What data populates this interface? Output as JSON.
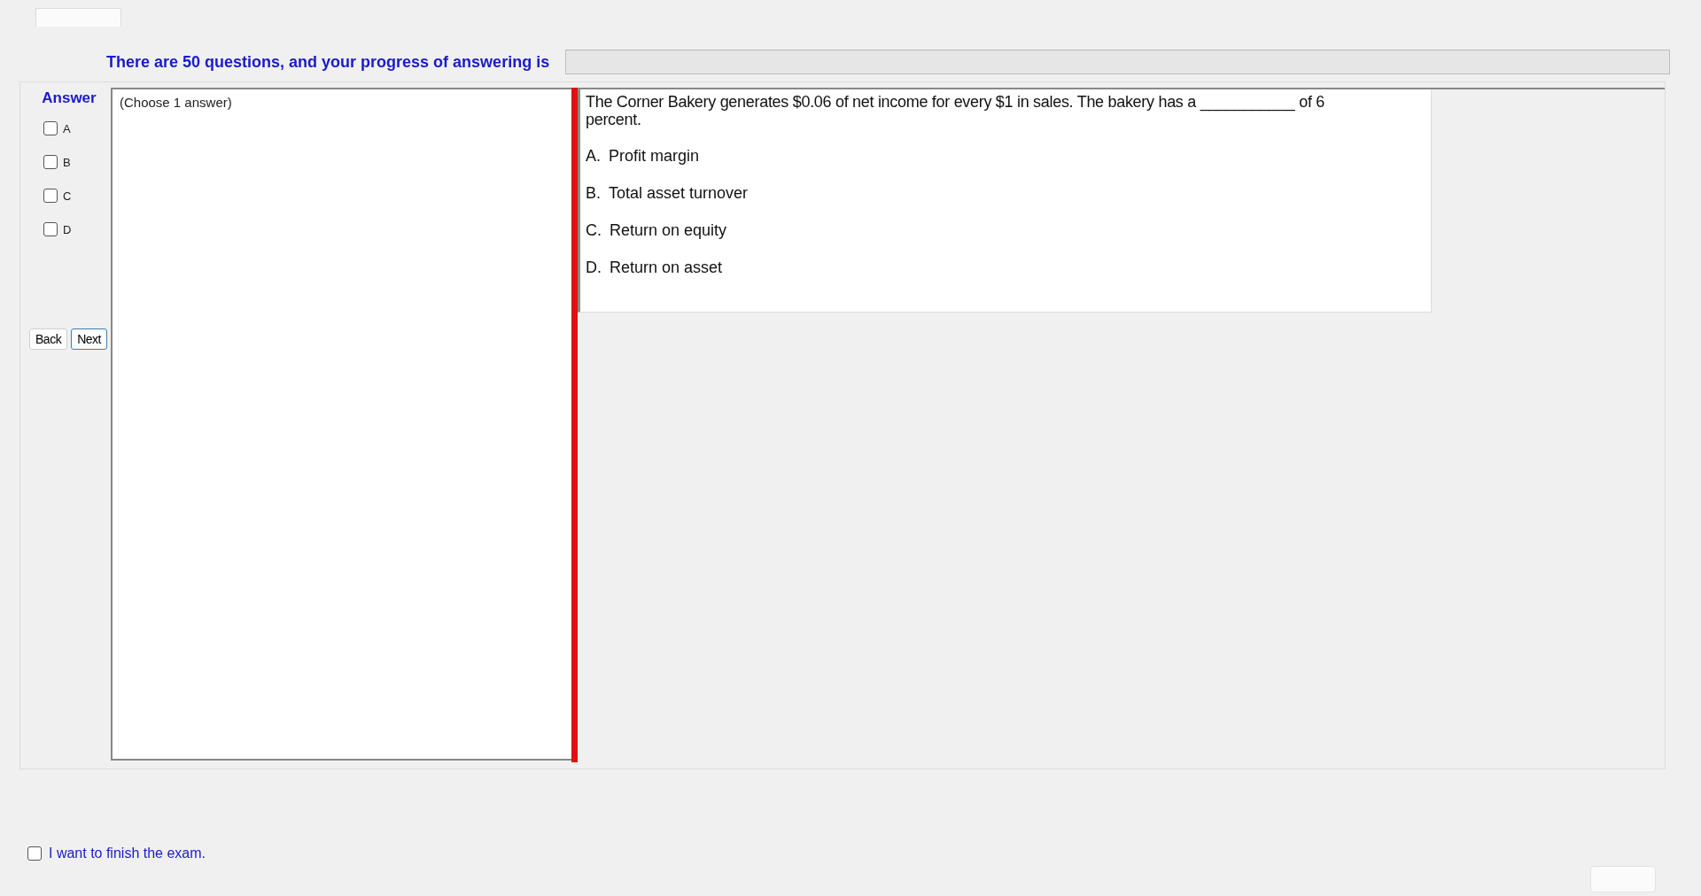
{
  "progress": {
    "label": "There are 50 questions, and your progress of answering is",
    "level": 0
  },
  "answer": {
    "title": "Answer",
    "options": [
      {
        "label": "A",
        "checked": false
      },
      {
        "label": "B",
        "checked": false
      },
      {
        "label": "C",
        "checked": false
      },
      {
        "label": "D",
        "checked": false
      }
    ]
  },
  "navigation": {
    "back": "Back",
    "next": "Next"
  },
  "answer_area": {
    "hint": "(Choose 1 answer)"
  },
  "question": {
    "text": "The Corner Bakery generates $0.06 of net income for every $1 in sales. The bakery has a ___________ of 6 percent.",
    "choices": [
      {
        "letter": "A.",
        "text": "Profit margin"
      },
      {
        "letter": "B.",
        "text": "Total asset turnover"
      },
      {
        "letter": "C.",
        "text": "Return on equity"
      },
      {
        "letter": "D.",
        "text": "Return on asset"
      }
    ]
  },
  "finish": {
    "label": "I want to finish the exam.",
    "checked": false
  }
}
